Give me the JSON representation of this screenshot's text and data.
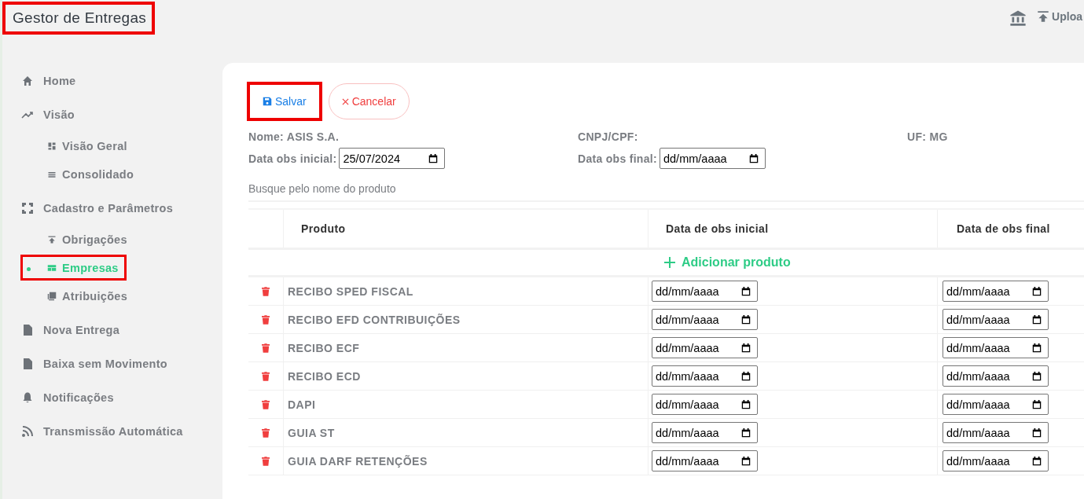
{
  "app_title": {
    "text": "Gestor de Entregas",
    "highlighted": true
  },
  "header_actions": [
    {
      "kind": "bank"
    },
    {
      "kind": "upload",
      "label": "Uploa"
    }
  ],
  "sidebar": {
    "items": [
      {
        "label": "Home",
        "selected": false,
        "highlighted": false
      },
      {
        "label": "Visão",
        "selected": false,
        "highlighted": false,
        "children": [
          {
            "label": "Visão Geral",
            "selected": false,
            "highlighted": false
          },
          {
            "label": "Consolidado",
            "selected": false,
            "highlighted": false
          }
        ]
      },
      {
        "label": "Cadastro e Parâmetros",
        "selected": false,
        "highlighted": false,
        "children": [
          {
            "label": "Obrigações",
            "selected": false,
            "highlighted": false
          },
          {
            "label": "Empresas",
            "selected": true,
            "highlighted": true
          },
          {
            "label": "Atribuições",
            "selected": false,
            "highlighted": false
          }
        ]
      },
      {
        "label": "Nova Entrega",
        "selected": false,
        "highlighted": false
      },
      {
        "label": "Baixa sem Movimento",
        "selected": false,
        "highlighted": false
      },
      {
        "label": "Notificações",
        "selected": false,
        "highlighted": false
      },
      {
        "label": "Transmissão Automática",
        "selected": false,
        "highlighted": false
      }
    ]
  },
  "buttons": [
    {
      "kind": "save",
      "label": "Salvar",
      "highlighted": true
    },
    {
      "kind": "cancel",
      "label": "Cancelar",
      "highlighted": false
    }
  ],
  "info": {
    "name": "Nome: ASIS S.A.",
    "cnpj": "CNPJ/CPF:",
    "uf": "UF: MG"
  },
  "dates": {
    "initial_label": "Data obs inicial:",
    "initial_value": "25/07/2024",
    "final_label": "Data obs final:",
    "final_value": "dd/mm/aaaa"
  },
  "search": {
    "placeholder": "Busque pelo nome do produto"
  },
  "table": {
    "columns": [
      "Produto",
      "Data de obs inicial",
      "Data de obs final"
    ],
    "add_label": "Adicionar produto",
    "rows": [
      {
        "product": "RECIBO SPED FISCAL",
        "initial": "dd/mm/aaaa",
        "final": "dd/mm/aaaa"
      },
      {
        "product": "RECIBO EFD CONTRIBUIÇÕES",
        "initial": "dd/mm/aaaa",
        "final": "dd/mm/aaaa"
      },
      {
        "product": "RECIBO ECF",
        "initial": "dd/mm/aaaa",
        "final": "dd/mm/aaaa"
      },
      {
        "product": "RECIBO ECD",
        "initial": "dd/mm/aaaa",
        "final": "dd/mm/aaaa"
      },
      {
        "product": "DAPI",
        "initial": "dd/mm/aaaa",
        "final": "dd/mm/aaaa"
      },
      {
        "product": "GUIA ST",
        "initial": "dd/mm/aaaa",
        "final": "dd/mm/aaaa"
      },
      {
        "product": "GUIA DARF RETENÇÕES",
        "initial": "dd/mm/aaaa",
        "final": "dd/mm/aaaa"
      }
    ]
  }
}
